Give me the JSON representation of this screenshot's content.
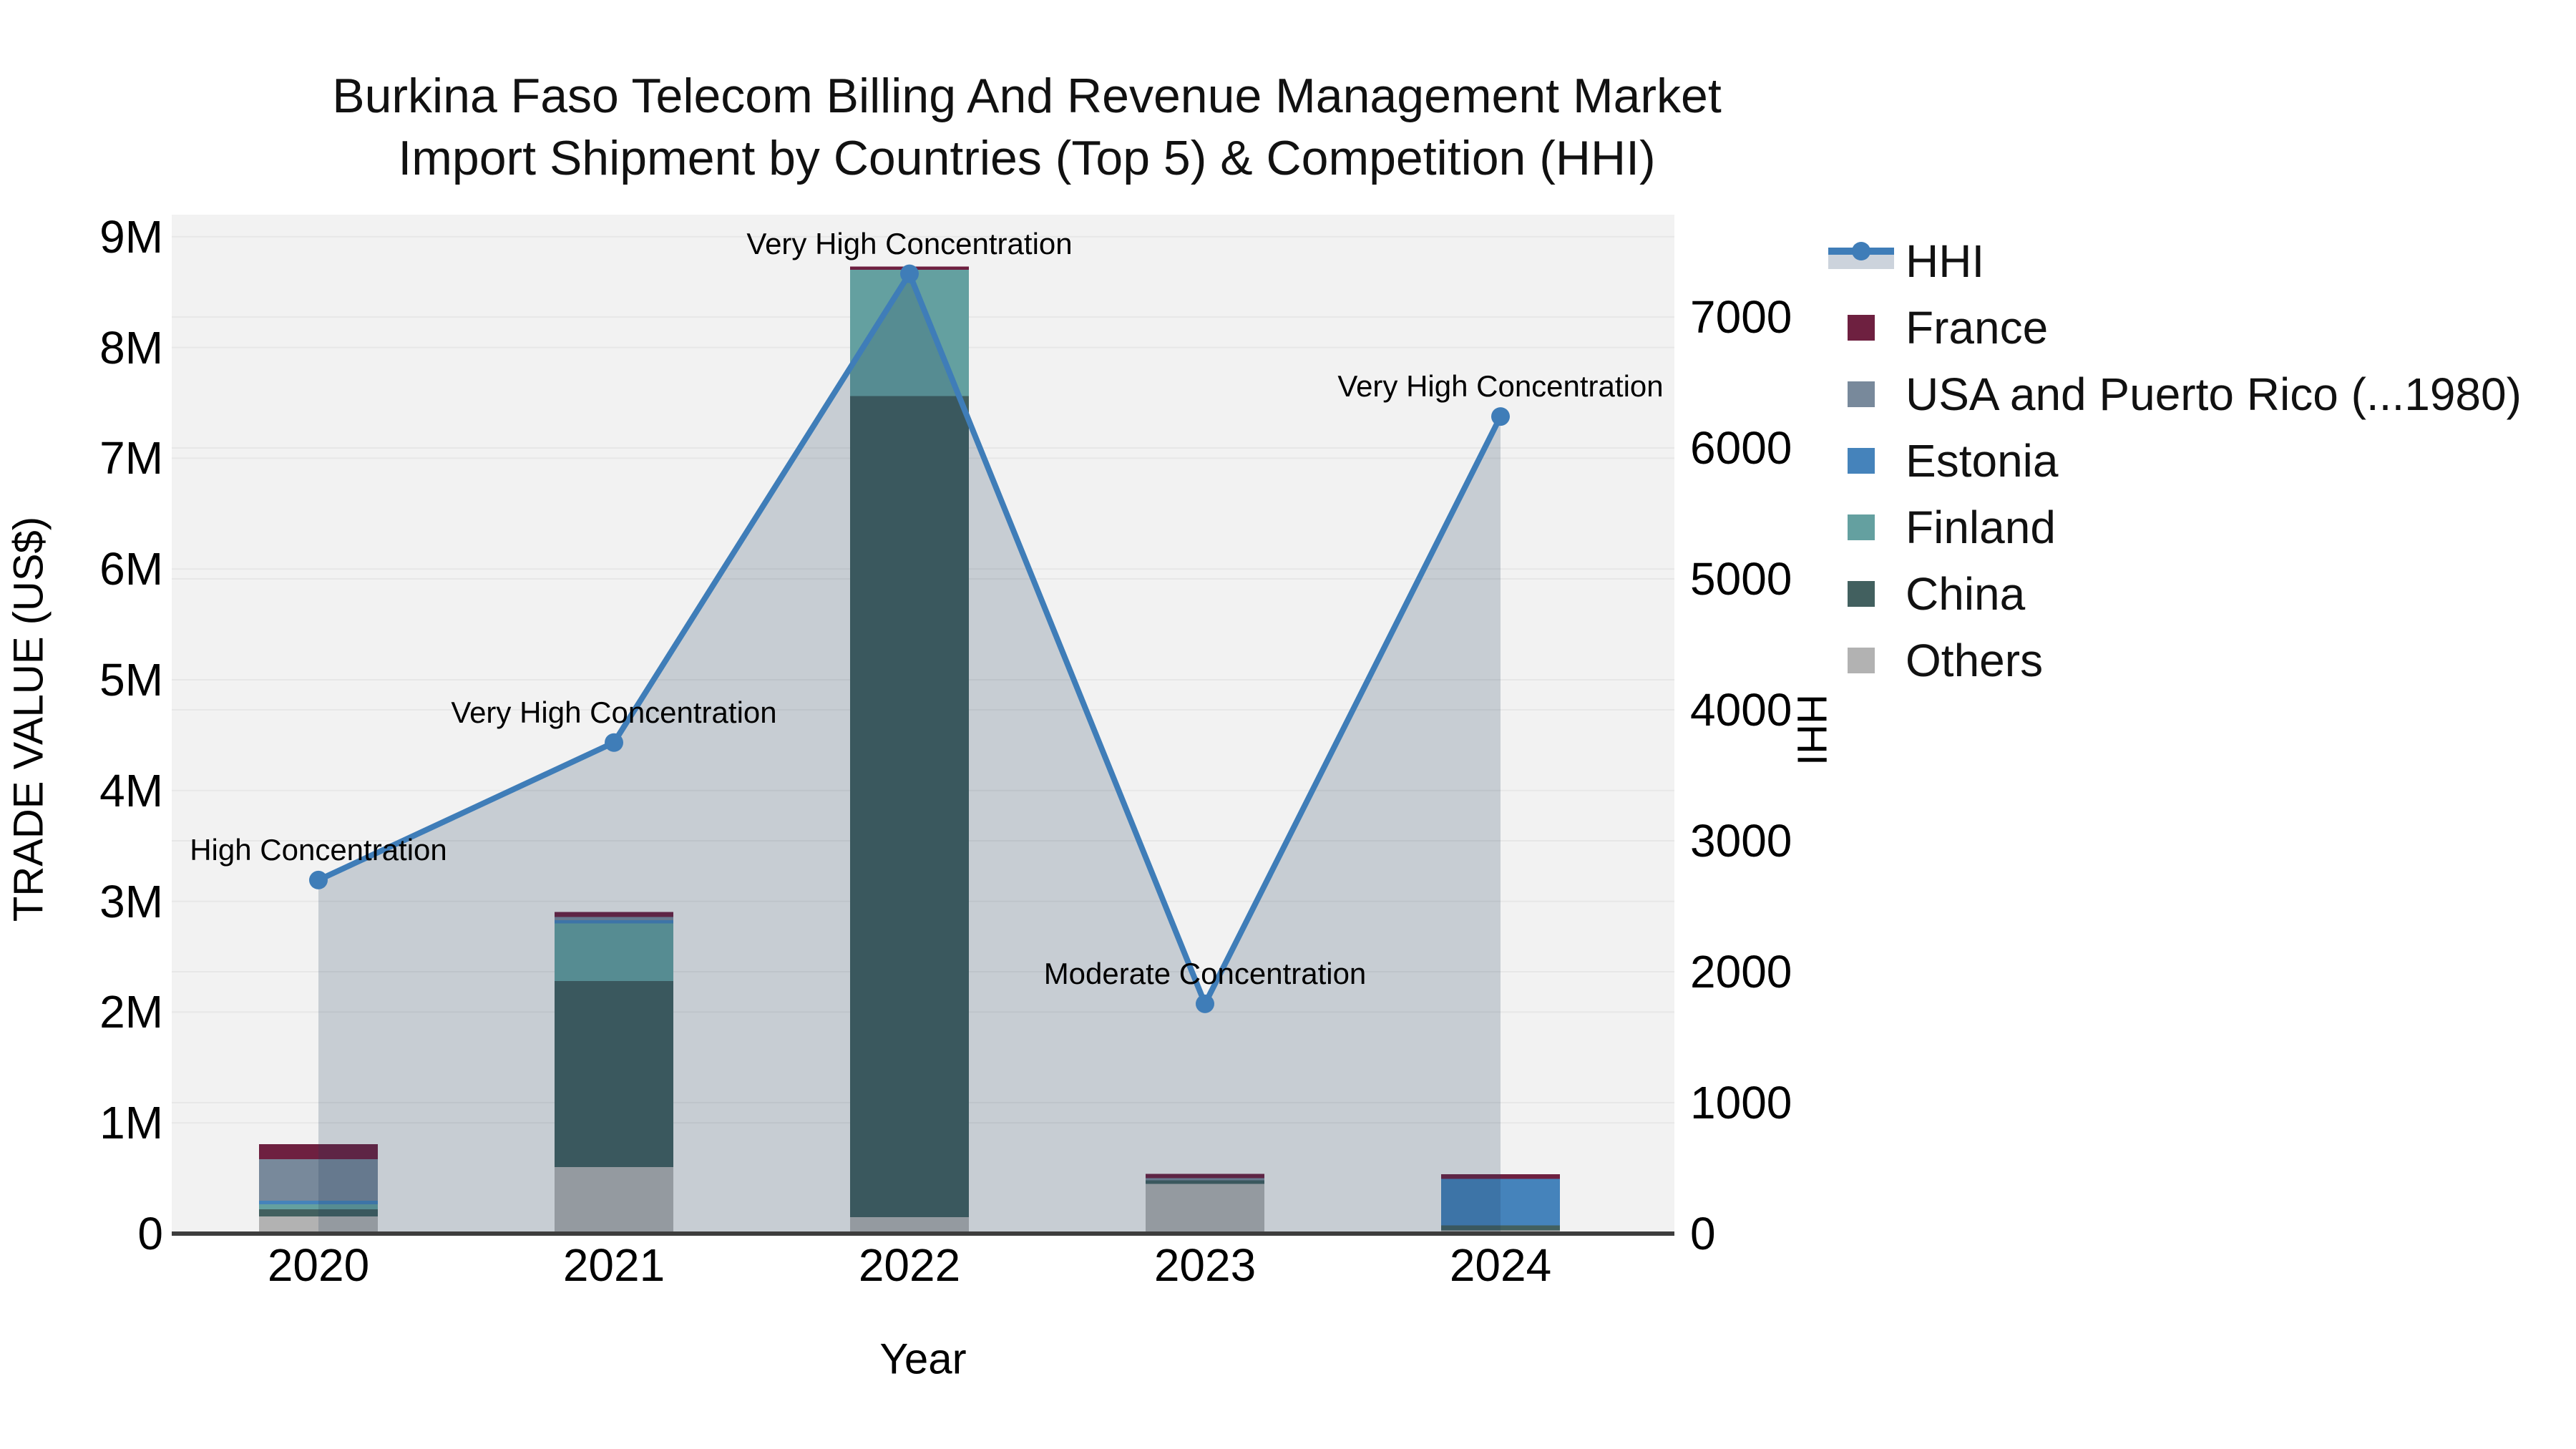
{
  "title": {
    "line1": "Burkina Faso Telecom Billing And Revenue Management Market",
    "line2": "Import Shipment by Countries (Top 5) & Competition (HHI)"
  },
  "axes": {
    "y_left": {
      "title": "TRADE VALUE (US$)",
      "ticks": [
        {
          "value": 0,
          "label": "0"
        },
        {
          "value": 1000000,
          "label": "1M"
        },
        {
          "value": 2000000,
          "label": "2M"
        },
        {
          "value": 3000000,
          "label": "3M"
        },
        {
          "value": 4000000,
          "label": "4M"
        },
        {
          "value": 5000000,
          "label": "5M"
        },
        {
          "value": 6000000,
          "label": "6M"
        },
        {
          "value": 7000000,
          "label": "7M"
        },
        {
          "value": 8000000,
          "label": "8M"
        },
        {
          "value": 9000000,
          "label": "9M"
        }
      ]
    },
    "y_right": {
      "title": "HHI",
      "ticks": [
        {
          "value": 0,
          "label": "0"
        },
        {
          "value": 1000,
          "label": "1000"
        },
        {
          "value": 2000,
          "label": "2000"
        },
        {
          "value": 3000,
          "label": "3000"
        },
        {
          "value": 4000,
          "label": "4000"
        },
        {
          "value": 5000,
          "label": "5000"
        },
        {
          "value": 6000,
          "label": "6000"
        },
        {
          "value": 7000,
          "label": "7000"
        }
      ]
    },
    "x": {
      "title": "Year"
    }
  },
  "legend": {
    "items": [
      {
        "label": "HHI",
        "type": "line",
        "color": "#3f7db8",
        "band": "#ccd3dc"
      },
      {
        "label": "France",
        "type": "patch",
        "color": "#6e2040"
      },
      {
        "label": "USA and Puerto Rico (...1980)",
        "type": "patch",
        "color": "#78899b"
      },
      {
        "label": "Estonia",
        "type": "patch",
        "color": "#4583bb"
      },
      {
        "label": "Finland",
        "type": "patch",
        "color": "#64a0a0"
      },
      {
        "label": "China",
        "type": "patch",
        "color": "#42605f"
      },
      {
        "label": "Others",
        "type": "patch",
        "color": "#b2b2b2"
      }
    ]
  },
  "chart_data": {
    "type": "bar",
    "subtype": "stacked-bars-with-line",
    "categories": [
      "2020",
      "2021",
      "2022",
      "2023",
      "2024"
    ],
    "xlabel": "Year",
    "ylabel_left": "TRADE VALUE (US$)",
    "ylabel_right": "HHI",
    "ylim_left": [
      0,
      9200000
    ],
    "ylim_right": [
      0,
      7790
    ],
    "grid": true,
    "legend_position": "outside-top-right",
    "series": [
      {
        "name": "Others",
        "color": "#b2b2b2",
        "values": [
          155000,
          600000,
          150000,
          450000,
          30000
        ]
      },
      {
        "name": "China",
        "color": "#42605f",
        "values": [
          65000,
          1680000,
          7410000,
          30000,
          45000
        ]
      },
      {
        "name": "Finland",
        "color": "#64a0a0",
        "values": [
          45000,
          520000,
          1140000,
          0,
          0
        ]
      },
      {
        "name": "Estonia",
        "color": "#4583bb",
        "values": [
          32000,
          30000,
          0,
          0,
          420000
        ]
      },
      {
        "name": "USA and Puerto Rico (...1980)",
        "color": "#78899b",
        "values": [
          375000,
          30000,
          0,
          20000,
          0
        ]
      },
      {
        "name": "France",
        "color": "#6e2040",
        "values": [
          135000,
          45000,
          30000,
          40000,
          40000
        ]
      }
    ],
    "line_series": {
      "name": "HHI",
      "axis": "right",
      "color": "#3f7db8",
      "area_fill": "rgba(30,60,90,0.2)",
      "values": [
        2700,
        3750,
        7330,
        1755,
        6240
      ]
    },
    "annotations": [
      {
        "category": "2020",
        "text": "High Concentration"
      },
      {
        "category": "2021",
        "text": "Very High Concentration"
      },
      {
        "category": "2022",
        "text": "Very High Concentration"
      },
      {
        "category": "2023",
        "text": "Moderate Concentration"
      },
      {
        "category": "2024",
        "text": "Very High Concentration"
      }
    ],
    "colors": {
      "plot_background": "#f2f2f2",
      "gridline": "#e7e7e7",
      "axis_line": "#3d3d3d"
    }
  }
}
